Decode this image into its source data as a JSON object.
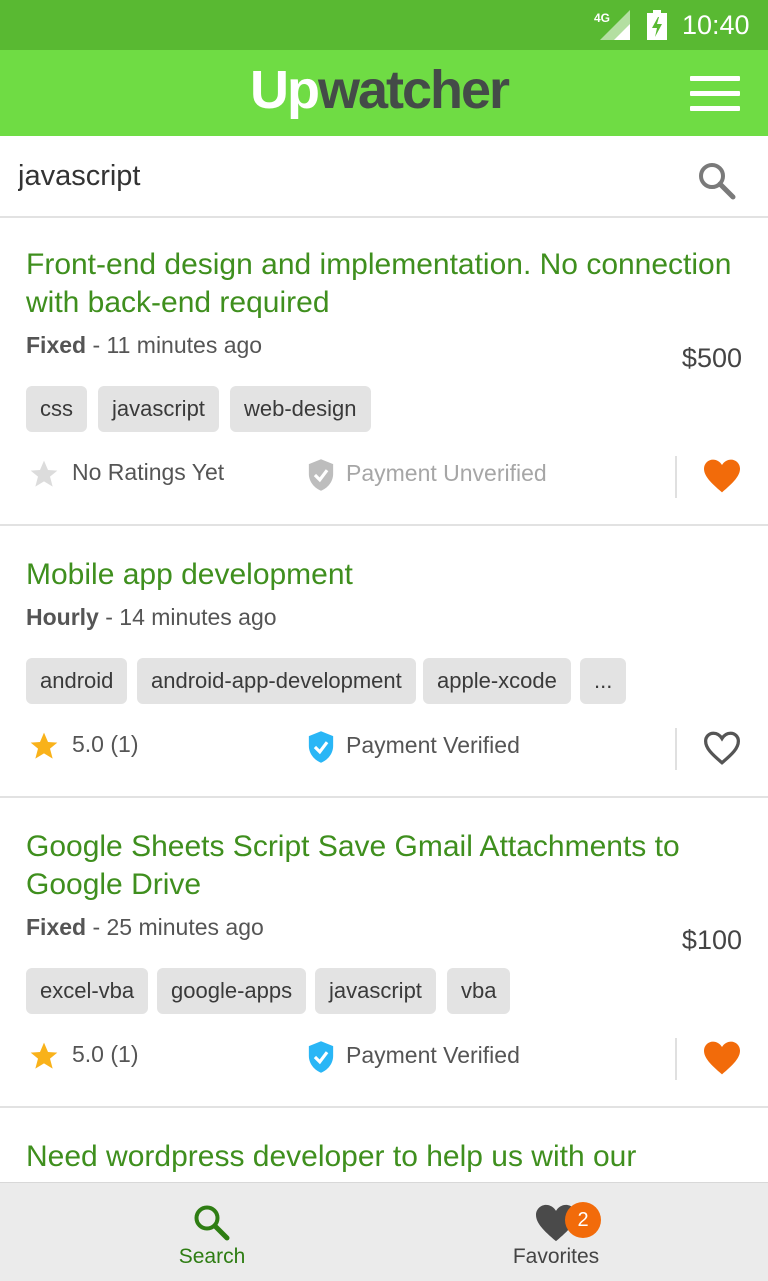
{
  "status_bar": {
    "network": "4G",
    "time": "10:40"
  },
  "app": {
    "logo_up": "Up",
    "logo_rest": "watcher",
    "menu_icon": "hamburger-icon"
  },
  "search": {
    "query": "javascript",
    "icon": "search-icon"
  },
  "jobs": [
    {
      "title": "Front-end design and implementation. No connection with back-end required",
      "type": "Fixed",
      "posted": " - 11 minutes ago",
      "price": "$500",
      "tags": [
        "css",
        "javascript",
        "web-design"
      ],
      "rating": "No Ratings Yet",
      "rated": false,
      "payment": "Payment Unverified",
      "payment_verified": false,
      "favorited": true
    },
    {
      "title": "Mobile app development",
      "type": "Hourly",
      "posted": " - 14 minutes ago",
      "price": "",
      "tags": [
        "android",
        "android-app-development",
        "apple-xcode",
        "..."
      ],
      "rating": "5.0 (1)",
      "rated": true,
      "payment": "Payment Verified",
      "payment_verified": true,
      "favorited": false
    },
    {
      "title": "Google Sheets Script Save Gmail Attachments to Google Drive",
      "type": "Fixed",
      "posted": " - 25 minutes ago",
      "price": "$100",
      "tags": [
        "excel-vba",
        "google-apps",
        "javascript",
        "vba"
      ],
      "rating": "5.0 (1)",
      "rated": true,
      "payment": "Payment Verified",
      "payment_verified": true,
      "favorited": true
    },
    {
      "title": "Need wordpress  developer to help us with our"
    }
  ],
  "bottom_nav": {
    "search_label": "Search",
    "favorites_label": "Favorites",
    "favorites_count": "2"
  },
  "colors": {
    "status_bar": "#59b932",
    "app_bar": "#6fdc44",
    "title_green": "#3f8f1e",
    "favorite_orange": "#f26b0a",
    "verified_blue": "#29b6f6",
    "star_yellow": "#f9b21a"
  }
}
